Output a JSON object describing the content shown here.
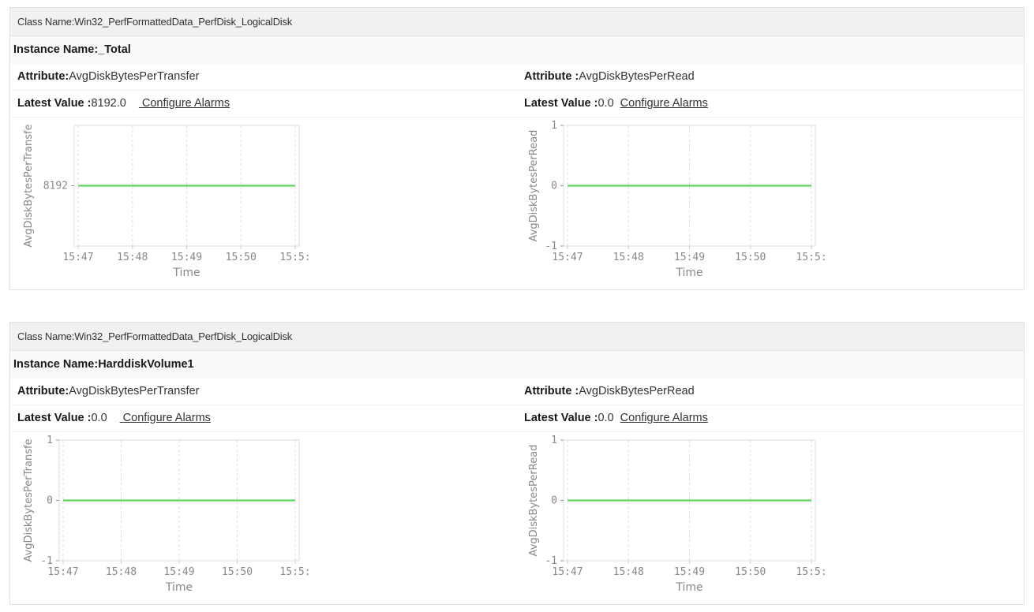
{
  "panels": [
    {
      "class_label": "Class Name:",
      "class_value": "Win32_PerfFormattedData_PerfDisk_LogicalDisk",
      "instance_label": "Instance Name:",
      "instance_value": "_Total",
      "left": {
        "attribute_label": "Attribute:",
        "attribute_value": "AvgDiskBytesPerTransfer",
        "latest_label": "Latest Value :",
        "latest_value": "8192.0",
        "configure_label": " Configure Alarms"
      },
      "right": {
        "attribute_label": "Attribute :",
        "attribute_value": "AvgDiskBytesPerRead",
        "latest_label": "Latest Value :",
        "latest_value": "0.0",
        "configure_label": "Configure Alarms"
      }
    },
    {
      "class_label": "Class Name:",
      "class_value": "Win32_PerfFormattedData_PerfDisk_LogicalDisk",
      "instance_label": "Instance Name:",
      "instance_value": "HarddiskVolume1",
      "left": {
        "attribute_label": "Attribute:",
        "attribute_value": "AvgDiskBytesPerTransfer",
        "latest_label": "Latest Value :",
        "latest_value": "0.0",
        "configure_label": " Configure Alarms"
      },
      "right": {
        "attribute_label": "Attribute :",
        "attribute_value": "AvgDiskBytesPerRead",
        "latest_label": "Latest Value :",
        "latest_value": "0.0",
        "configure_label": "Configure Alarms"
      }
    }
  ],
  "colors": {
    "line": "#5cd65c",
    "grid": "#dddddd",
    "axis": "#cccccc",
    "tick_text": "#888888"
  },
  "chart_data": [
    {
      "type": "line",
      "panel": 0,
      "side": "left",
      "ylabel": "AvgDiskBytesPerTransfe",
      "xlabel": "Time",
      "x": [
        "15:47",
        "15:48",
        "15:49",
        "15:50",
        "15:5:"
      ],
      "yticks": [
        "8192"
      ],
      "series": [
        {
          "values": [
            8192,
            8192,
            8192,
            8192,
            8192
          ]
        }
      ],
      "ylim": [
        8191,
        8193
      ],
      "grid": true
    },
    {
      "type": "line",
      "panel": 0,
      "side": "right",
      "ylabel": "AvgDiskBytesPerRead",
      "xlabel": "Time",
      "x": [
        "15:47",
        "15:48",
        "15:49",
        "15:50",
        "15:5:"
      ],
      "yticks": [
        "1",
        "0",
        "-1"
      ],
      "series": [
        {
          "values": [
            0,
            0,
            0,
            0,
            0
          ]
        }
      ],
      "ylim": [
        -1,
        1
      ],
      "grid": true
    },
    {
      "type": "line",
      "panel": 1,
      "side": "left",
      "ylabel": "AvgDiskBytesPerTransfe",
      "xlabel": "Time",
      "x": [
        "15:47",
        "15:48",
        "15:49",
        "15:50",
        "15:5:"
      ],
      "yticks": [
        "1",
        "0",
        "-1"
      ],
      "series": [
        {
          "values": [
            0,
            0,
            0,
            0,
            0
          ]
        }
      ],
      "ylim": [
        -1,
        1
      ],
      "grid": true
    },
    {
      "type": "line",
      "panel": 1,
      "side": "right",
      "ylabel": "AvgDiskBytesPerRead",
      "xlabel": "Time",
      "x": [
        "15:47",
        "15:48",
        "15:49",
        "15:50",
        "15:5:"
      ],
      "yticks": [
        "1",
        "0",
        "-1"
      ],
      "series": [
        {
          "values": [
            0,
            0,
            0,
            0,
            0
          ]
        }
      ],
      "ylim": [
        -1,
        1
      ],
      "grid": true
    }
  ]
}
